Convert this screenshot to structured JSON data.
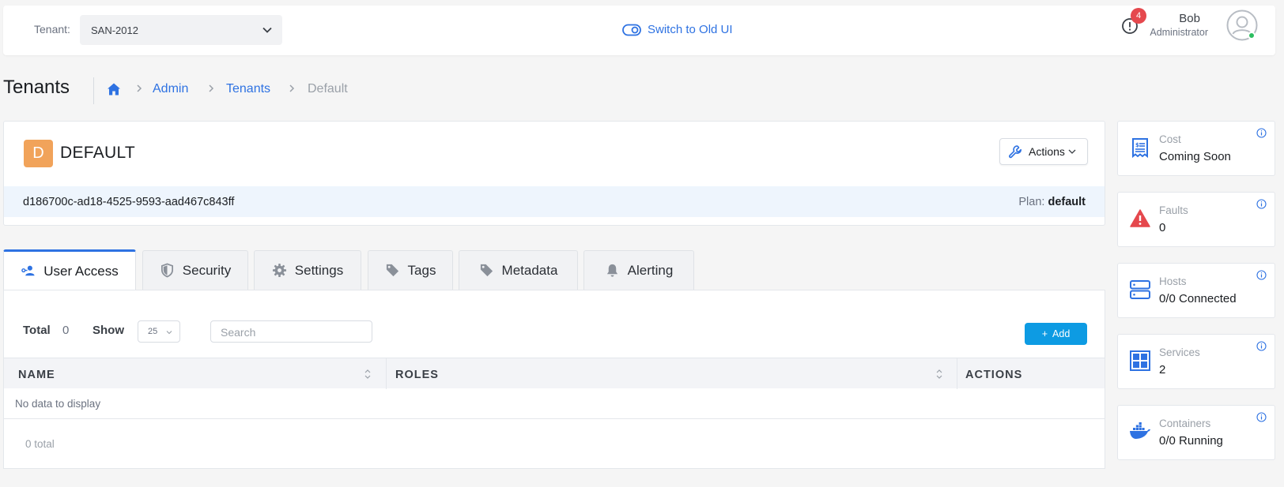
{
  "topbar": {
    "tenant_label": "Tenant:",
    "tenant_value": "SAN-2012",
    "switch_label": "Switch to Old UI",
    "notif_count": "4",
    "user_name": "Bob",
    "user_role": "Administrator"
  },
  "header": {
    "title": "Tenants",
    "breadcrumb": [
      "Admin",
      "Tenants",
      "Default"
    ]
  },
  "tenant": {
    "letter": "D",
    "name": "DEFAULT",
    "actions_label": "Actions",
    "id": "d186700c-ad18-4525-9593-aad467c843ff",
    "plan_label": "Plan:",
    "plan_value": "default"
  },
  "tabs": [
    {
      "label": "User Access",
      "icon": "users-icon",
      "active": true
    },
    {
      "label": "Security",
      "icon": "shield-icon"
    },
    {
      "label": "Settings",
      "icon": "gear-icon"
    },
    {
      "label": "Tags",
      "icon": "tag-icon"
    },
    {
      "label": "Metadata",
      "icon": "tag-icon"
    },
    {
      "label": "Alerting",
      "icon": "bell-icon"
    }
  ],
  "table": {
    "total_label": "Total",
    "total_value": "0",
    "show_label": "Show",
    "show_value": "25",
    "search_placeholder": "Search",
    "add_label": "Add",
    "columns": [
      "NAME",
      "ROLES",
      "ACTIONS"
    ],
    "empty_text": "No data to display",
    "footer_total": "0 total"
  },
  "side_cards": [
    {
      "label": "Cost",
      "value": "Coming Soon",
      "icon": "receipt-icon",
      "color": "#2e72e2"
    },
    {
      "label": "Faults",
      "value": "0",
      "icon": "warning-icon",
      "color": "#e5484d"
    },
    {
      "label": "Hosts",
      "value": "0/0 Connected",
      "icon": "server-icon",
      "color": "#2e72e2"
    },
    {
      "label": "Services",
      "value": "2",
      "icon": "grid-icon",
      "color": "#2e72e2"
    },
    {
      "label": "Containers",
      "value": "0/0 Running",
      "icon": "docker-icon",
      "color": "#2e72e2"
    }
  ],
  "colors": {
    "accent": "#2e72e2",
    "add_button": "#0d9be3",
    "badge": "#e5484d",
    "tenant_letter_bg": "#f1a35a",
    "online": "#2dbe60"
  }
}
